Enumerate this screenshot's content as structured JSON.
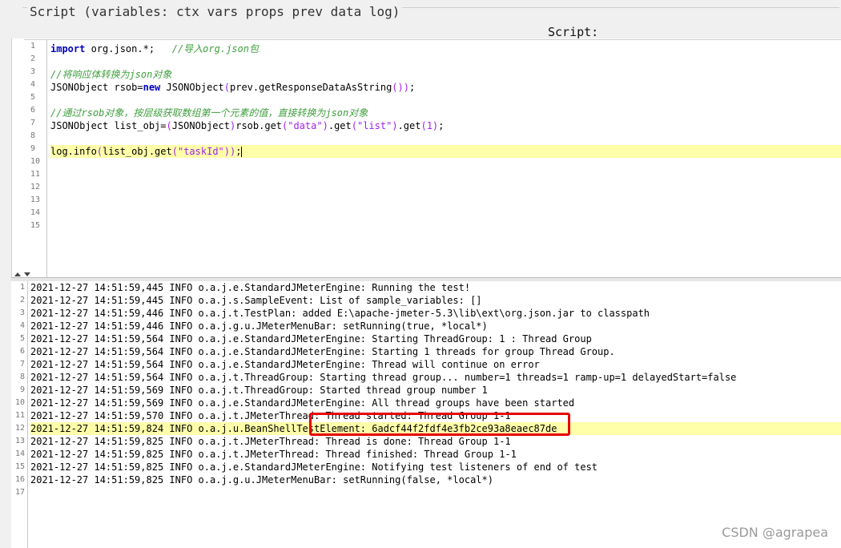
{
  "header": {
    "title": "Script (variables: ctx vars props prev data log)",
    "script_label": "Script:"
  },
  "editor": {
    "line_numbers": [
      "1",
      "2",
      "3",
      "4",
      "5",
      "6",
      "7",
      "8",
      "9",
      "10",
      "11",
      "12",
      "13",
      "14",
      "15"
    ],
    "lines": [
      {
        "tokens": [
          {
            "t": "import",
            "c": "kw"
          },
          {
            "t": " org.json.*;   "
          },
          {
            "t": "//导入org.json包",
            "c": "cm"
          }
        ]
      },
      {
        "tokens": []
      },
      {
        "tokens": [
          {
            "t": "//将响应体转换为json对象",
            "c": "cm"
          }
        ]
      },
      {
        "tokens": [
          {
            "t": "JSONObject rsob="
          },
          {
            "t": "new",
            "c": "kw"
          },
          {
            "t": " JSONObject"
          },
          {
            "t": "(",
            "c": "pn"
          },
          {
            "t": "prev.getResponseDataAsString"
          },
          {
            "t": "())",
            "c": "pn"
          },
          {
            "t": ";"
          }
        ]
      },
      {
        "tokens": []
      },
      {
        "tokens": [
          {
            "t": "//通过rsob对象，按层级获取数组第一个元素的值，直接转换为json对象",
            "c": "cm"
          }
        ]
      },
      {
        "tokens": [
          {
            "t": "JSONObject list_obj="
          },
          {
            "t": "(",
            "c": "pn"
          },
          {
            "t": "JSONObject"
          },
          {
            "t": ")",
            "c": "pn"
          },
          {
            "t": "rsob.get"
          },
          {
            "t": "(",
            "c": "pn"
          },
          {
            "t": "\"data\"",
            "c": "st"
          },
          {
            "t": ")",
            "c": "pn"
          },
          {
            "t": ".get"
          },
          {
            "t": "(",
            "c": "pn"
          },
          {
            "t": "\"list\"",
            "c": "st"
          },
          {
            "t": ")",
            "c": "pn"
          },
          {
            "t": ".get"
          },
          {
            "t": "(1)",
            "c": "pn"
          },
          {
            "t": ";"
          }
        ]
      },
      {
        "tokens": []
      },
      {
        "tokens": [
          {
            "t": "log.info"
          },
          {
            "t": "(",
            "c": "pn"
          },
          {
            "t": "list_obj.get"
          },
          {
            "t": "(",
            "c": "pn"
          },
          {
            "t": "\"taskId\"",
            "c": "st"
          },
          {
            "t": "))",
            "c": "pn"
          },
          {
            "t": ";"
          }
        ],
        "highlight": true,
        "cursor": true
      },
      {
        "tokens": []
      },
      {
        "tokens": []
      },
      {
        "tokens": []
      },
      {
        "tokens": []
      },
      {
        "tokens": []
      },
      {
        "tokens": []
      }
    ]
  },
  "log": {
    "line_numbers": [
      "1",
      "2",
      "3",
      "4",
      "5",
      "6",
      "7",
      "8",
      "9",
      "10",
      "11",
      "12",
      "13",
      "14",
      "15",
      "16",
      "17"
    ],
    "lines": [
      "2021-12-27 14:51:59,445 INFO o.a.j.e.StandardJMeterEngine: Running the test!",
      "2021-12-27 14:51:59,445 INFO o.a.j.s.SampleEvent: List of sample_variables: []",
      "2021-12-27 14:51:59,446 INFO o.a.j.t.TestPlan: added E:\\apache-jmeter-5.3\\lib\\ext\\org.json.jar to classpath",
      "2021-12-27 14:51:59,446 INFO o.a.j.g.u.JMeterMenuBar: setRunning(true, *local*)",
      "2021-12-27 14:51:59,564 INFO o.a.j.e.StandardJMeterEngine: Starting ThreadGroup: 1 : Thread Group",
      "2021-12-27 14:51:59,564 INFO o.a.j.e.StandardJMeterEngine: Starting 1 threads for group Thread Group.",
      "2021-12-27 14:51:59,564 INFO o.a.j.e.StandardJMeterEngine: Thread will continue on error",
      "2021-12-27 14:51:59,564 INFO o.a.j.t.ThreadGroup: Starting thread group... number=1 threads=1 ramp-up=1 delayedStart=false",
      "2021-12-27 14:51:59,569 INFO o.a.j.t.ThreadGroup: Started thread group number 1",
      "2021-12-27 14:51:59,569 INFO o.a.j.e.StandardJMeterEngine: All thread groups have been started",
      "2021-12-27 14:51:59,570 INFO o.a.j.t.JMeterThread: Thread started: Thread Group 1-1",
      "2021-12-27 14:51:59,824 INFO o.a.j.u.BeanShellTestElement: 6adcf44f2fdf4e3fb2ce93a8eaec87de",
      "2021-12-27 14:51:59,825 INFO o.a.j.t.JMeterThread: Thread is done: Thread Group 1-1",
      "2021-12-27 14:51:59,825 INFO o.a.j.t.JMeterThread: Thread finished: Thread Group 1-1",
      "2021-12-27 14:51:59,825 INFO o.a.j.e.StandardJMeterEngine: Notifying test listeners of end of test",
      "2021-12-27 14:51:59,825 INFO o.a.j.g.u.JMeterMenuBar: setRunning(false, *local*)",
      ""
    ],
    "highlight_index": 11
  },
  "watermark": "CSDN @agrapea",
  "colors": {
    "highlight": "#ffffaa",
    "keyword": "#0000c0",
    "comment": "#3f9f3f",
    "string": "#a020f0",
    "annotation": "#e60000"
  }
}
